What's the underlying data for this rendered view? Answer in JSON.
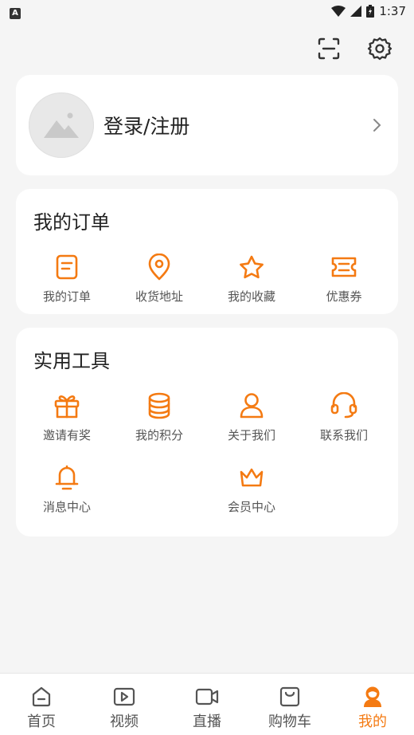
{
  "status_bar": {
    "time": "1:37"
  },
  "profile": {
    "login_label": "登录/注册"
  },
  "orders": {
    "title": "我的订单",
    "items": [
      {
        "label": "我的订单",
        "icon": "order-list-icon"
      },
      {
        "label": "收货地址",
        "icon": "location-pin-icon"
      },
      {
        "label": "我的收藏",
        "icon": "star-icon"
      },
      {
        "label": "优惠券",
        "icon": "coupon-icon"
      }
    ]
  },
  "tools": {
    "title": "实用工具",
    "items": [
      {
        "label": "邀请有奖",
        "icon": "gift-icon"
      },
      {
        "label": "我的积分",
        "icon": "coins-icon"
      },
      {
        "label": "关于我们",
        "icon": "user-icon"
      },
      {
        "label": "联系我们",
        "icon": "headset-icon"
      },
      {
        "label": "消息中心",
        "icon": "bell-icon"
      },
      {
        "label": "会员中心",
        "icon": "crown-icon"
      }
    ]
  },
  "tabs": [
    {
      "label": "首页",
      "icon": "home-icon"
    },
    {
      "label": "视频",
      "icon": "video-icon"
    },
    {
      "label": "直播",
      "icon": "live-camera-icon"
    },
    {
      "label": "购物车",
      "icon": "cart-bag-icon"
    },
    {
      "label": "我的",
      "icon": "profile-icon",
      "active": true
    }
  ],
  "colors": {
    "accent": "#f47a12",
    "background": "#f5f5f5",
    "card": "#ffffff"
  }
}
